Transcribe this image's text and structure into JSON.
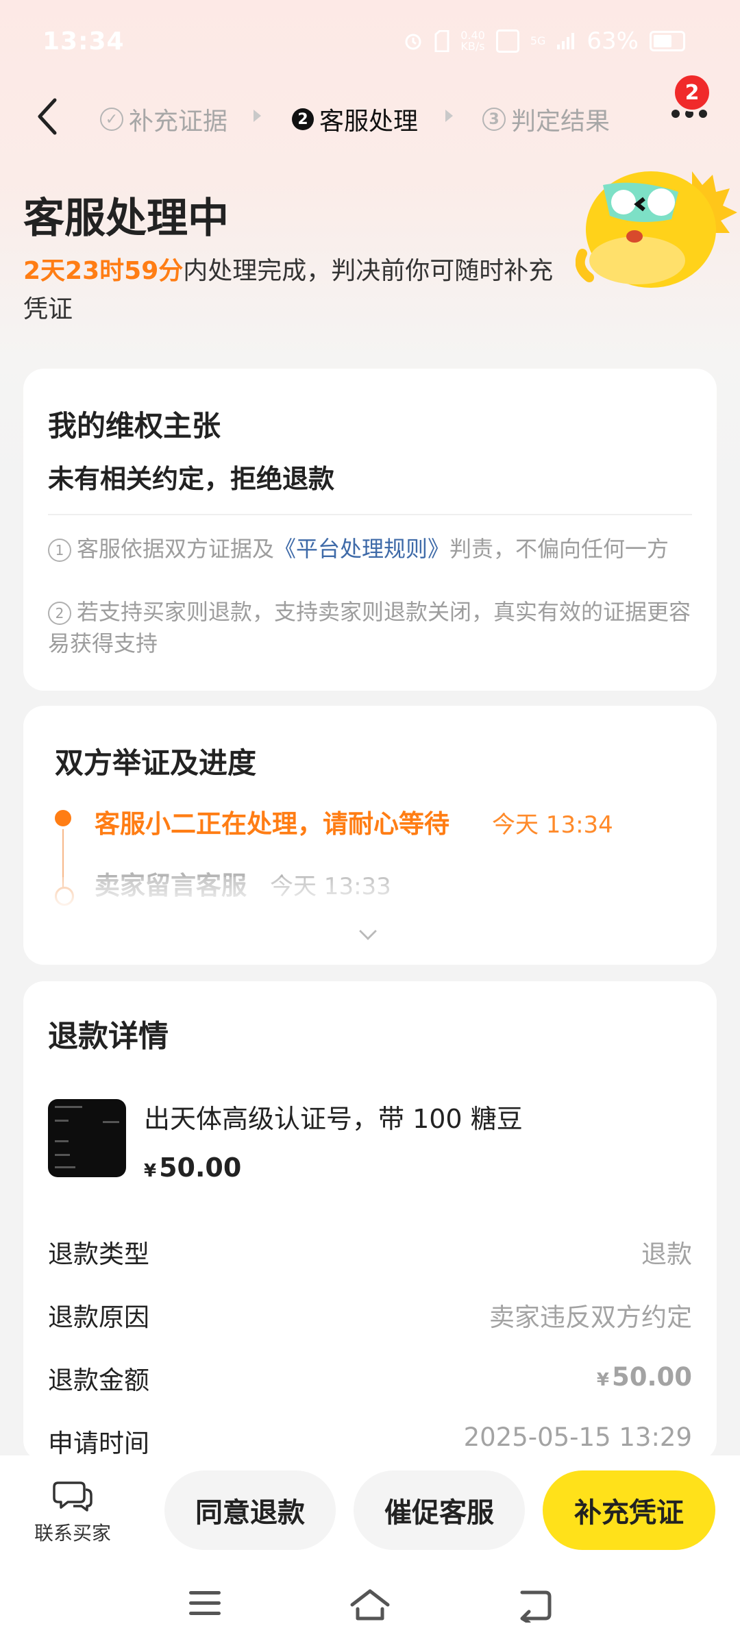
{
  "status_bar": {
    "time": "13:34",
    "net_speed_top": "0.40",
    "net_speed_unit": "KB/s",
    "signal_label": "5G",
    "battery": "63%"
  },
  "header_nav": {
    "steps": [
      {
        "num": "✓",
        "label": "补充证据",
        "active": false
      },
      {
        "num": "2",
        "label": "客服处理",
        "active": true
      },
      {
        "num": "3",
        "label": "判定结果",
        "active": false
      }
    ],
    "badge_count": "2"
  },
  "hero": {
    "title": "客服处理中",
    "countdown": "2天23时59分",
    "desc_rest": "内处理完成，判决前你可随时补充凭证"
  },
  "claim_card": {
    "title": "我的维权主张",
    "claim": "未有相关约定，拒绝退款",
    "note1_num": "1",
    "note1_pre": "客服依据双方证据及",
    "note1_link": "《平台处理规则》",
    "note1_post": "判责，不偏向任何一方",
    "note2_num": "2",
    "note2": "若支持买家则退款，支持卖家则退款关闭，真实有效的证据更容易获得支持"
  },
  "progress_card": {
    "title": "双方举证及进度",
    "items": [
      {
        "text": "客服小二正在处理，请耐心等待",
        "time": "今天 13:34"
      },
      {
        "text": "卖家留言客服",
        "time": "今天 13:33"
      }
    ]
  },
  "refund_card": {
    "title": "退款详情",
    "product_name": "出天体高级认证号，带 100 糖豆",
    "price_symbol": "¥",
    "price": "50.00",
    "rows": [
      {
        "key": "退款类型",
        "value": "退款"
      },
      {
        "key": "退款原因",
        "value": "卖家违反双方约定"
      },
      {
        "key": "退款金额",
        "symbol": "¥",
        "value": "50.00"
      },
      {
        "key": "申请时间",
        "value": "2025-05-15 13:29"
      }
    ]
  },
  "bottom_bar": {
    "contact_label": "联系买家",
    "agree_label": "同意退款",
    "urge_label": "催促客服",
    "supplement_label": "补充凭证"
  },
  "colors": {
    "accent_orange": "#ff7d14",
    "primary_yellow": "#ffe11a",
    "link_blue": "#3e6aa8",
    "badge_red": "#f02a2a"
  }
}
